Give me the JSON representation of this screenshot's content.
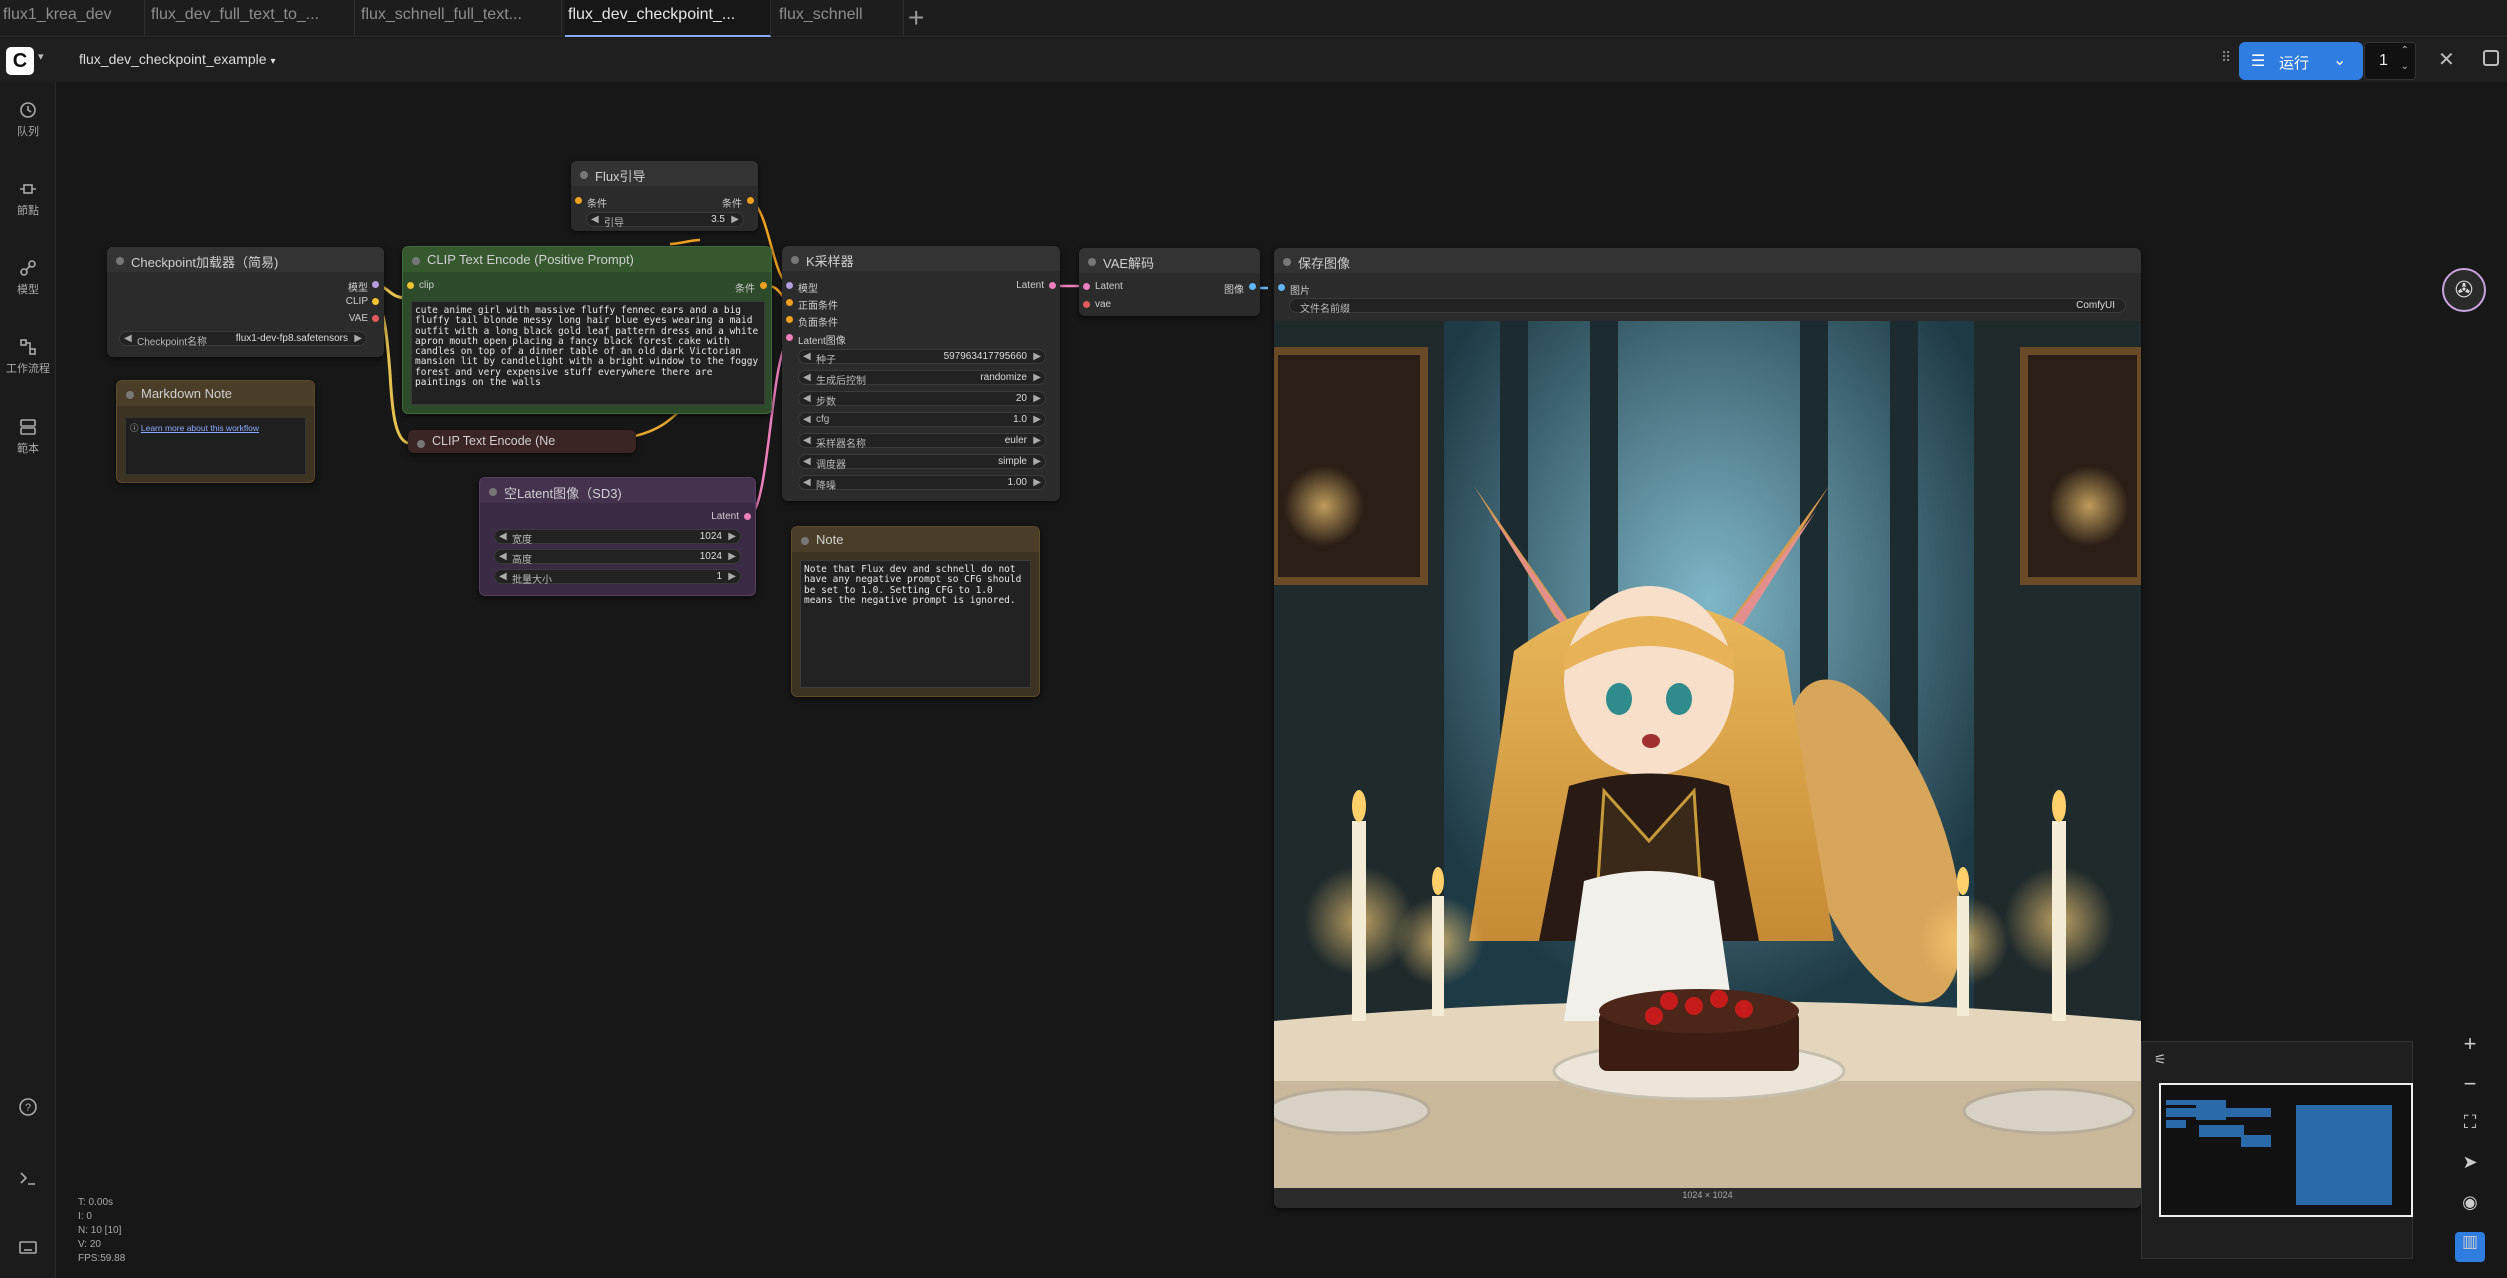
{
  "tabs": [
    {
      "label": "flux1_krea_dev"
    },
    {
      "label": "flux_dev_full_text_to_..."
    },
    {
      "label": "flux_schnell_full_text..."
    },
    {
      "label": "flux_dev_checkpoint_..."
    },
    {
      "label": "flux_schnell"
    }
  ],
  "workflow_title": "flux_dev_checkpoint_example",
  "run": {
    "label": "运行",
    "count": "1"
  },
  "sidebar": [
    {
      "label": "队列",
      "icon": "history-icon"
    },
    {
      "label": "節點",
      "icon": "node-icon"
    },
    {
      "label": "模型",
      "icon": "model-icon"
    },
    {
      "label": "工作流程",
      "icon": "workflow-icon"
    },
    {
      "label": "範本",
      "icon": "template-icon"
    }
  ],
  "nodes": {
    "checkpoint": {
      "title": "Checkpoint加载器（简易)",
      "out_model": "模型",
      "out_clip": "CLIP",
      "out_vae": "VAE",
      "w_name": "Checkpoint名称",
      "w_value": "flux1-dev-fp8.safetensors"
    },
    "markdown": {
      "title": "Markdown Note",
      "link": "Learn more about this workflow"
    },
    "flux_guide": {
      "title": "Flux引导",
      "in": "条件",
      "out": "条件",
      "w_name": "引导",
      "w_value": "3.5"
    },
    "clip_pos": {
      "title": "CLIP Text Encode (Positive Prompt)",
      "in": "clip",
      "out": "条件",
      "text": "cute anime girl with massive fluffy fennec ears and a big fluffy tail blonde messy long hair blue eyes wearing a maid outfit with a long black gold leaf pattern dress and a white apron mouth open placing a fancy black forest cake with candles on top of a dinner table of an old dark Victorian mansion lit by candlelight with a bright window to the foggy forest and very expensive stuff everywhere there are paintings on the walls"
    },
    "clip_neg": {
      "title": "CLIP Text Encode (Ne"
    },
    "latent": {
      "title": "空Latent图像（SD3)",
      "out": "Latent",
      "widgets": [
        {
          "name": "宽度",
          "value": "1024"
        },
        {
          "name": "高度",
          "value": "1024"
        },
        {
          "name": "批量大小",
          "value": "1"
        }
      ]
    },
    "ksampler": {
      "title": "K采样器",
      "inputs": [
        "模型",
        "正面条件",
        "负面条件",
        "Latent图像"
      ],
      "out": "Latent",
      "widgets": [
        {
          "name": "种子",
          "value": "597963417795660"
        },
        {
          "name": "生成后控制",
          "value": "randomize"
        },
        {
          "name": "步数",
          "value": "20"
        },
        {
          "name": "cfg",
          "value": "1.0"
        },
        {
          "name": "采样器名称",
          "value": "euler"
        },
        {
          "name": "调度器",
          "value": "simple"
        },
        {
          "name": "降噪",
          "value": "1.00"
        }
      ]
    },
    "note": {
      "title": "Note",
      "text": "Note that Flux dev and schnell do not have any negative prompt so CFG should be set to 1.0. Setting CFG to 1.0 means the negative prompt is ignored."
    },
    "vae_decode": {
      "title": "VAE解码",
      "in_latent": "Latent",
      "in_vae": "vae",
      "out": "图像"
    },
    "save_image": {
      "title": "保存图像",
      "in": "图片",
      "w_name": "文件名前缀",
      "w_value": "ComfyUI",
      "size_label": "1024 × 1024"
    }
  },
  "stats": {
    "t": "T: 0.00s",
    "i": "I: 0",
    "n": "N: 10 [10]",
    "v": "V: 20",
    "fps": "FPS:59.88"
  },
  "colors": {
    "accent": "#2f7de1",
    "clip_green": "#2d4a2b",
    "latent_purple": "#3a2a43",
    "note_brown": "#3c3323"
  }
}
